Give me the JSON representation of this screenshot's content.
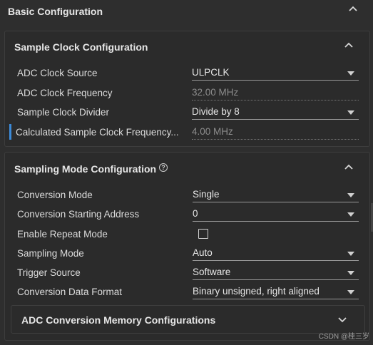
{
  "basic": {
    "title": "Basic Configuration"
  },
  "sample_clock": {
    "title": "Sample Clock Configuration",
    "rows": [
      {
        "label": "ADC Clock Source",
        "value": "ULPCLK"
      },
      {
        "label": "ADC Clock Frequency",
        "value": "32.00 MHz"
      },
      {
        "label": "Sample Clock Divider",
        "value": "Divide by 8"
      },
      {
        "label": "Calculated Sample Clock Frequency...",
        "value": "4.00 MHz"
      }
    ]
  },
  "sampling_mode": {
    "title": "Sampling Mode Configuration",
    "help": "?",
    "rows": [
      {
        "label": "Conversion Mode",
        "value": "Single"
      },
      {
        "label": "Conversion Starting Address",
        "value": "0"
      },
      {
        "label": "Enable Repeat Mode",
        "checked": false
      },
      {
        "label": "Sampling Mode",
        "value": "Auto"
      },
      {
        "label": "Trigger Source",
        "value": "Software"
      },
      {
        "label": "Conversion Data Format",
        "value": "Binary unsigned, right aligned"
      }
    ]
  },
  "memory": {
    "title": "ADC Conversion Memory Configurations"
  },
  "watermark": "CSDN @桂三岁",
  "colors": {
    "background": "#2e2e2e",
    "accent_marker": "#3c8ad8"
  }
}
